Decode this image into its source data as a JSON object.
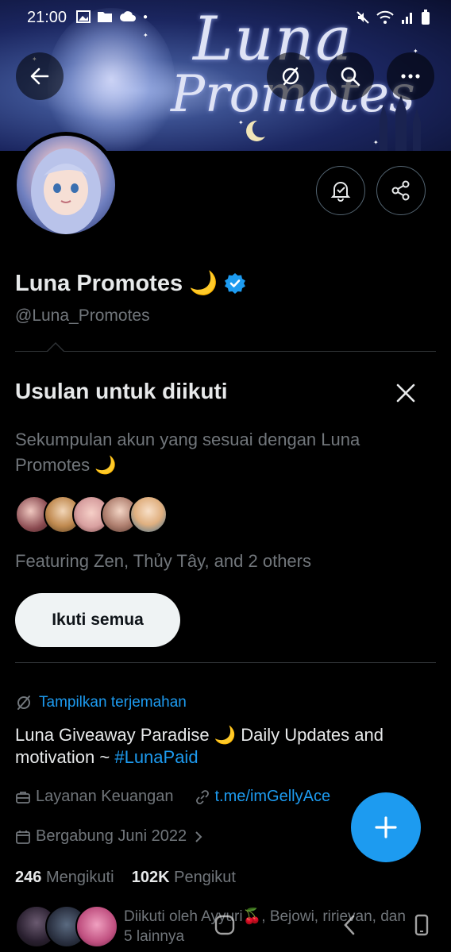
{
  "status_bar": {
    "time": "21:00"
  },
  "banner": {
    "brand_line1": "Luna",
    "brand_line2": "Promotes"
  },
  "profile": {
    "name": "Luna Promotes",
    "name_emoji": "🌙",
    "handle": "@Luna_Promotes",
    "verified_color": "#1d9bf0"
  },
  "suggestions": {
    "title": "Usulan untuk diikuti",
    "description": "Sekumpulan akun yang sesuai dengan Luna Promotes 🌙",
    "featuring": "Featuring Zen, Thủy Tây, and 2 others",
    "follow_all_label": "Ikuti semua"
  },
  "bio": {
    "translate_label": "Tampilkan terjemahan",
    "text_before_tag": "Luna Giveaway Paradise 🌙 Daily Updates and motivation ~ ",
    "hashtag": "#LunaPaid"
  },
  "meta": {
    "category": "Layanan Keuangan",
    "link": "t.me/imGellyAce",
    "joined": "Bergabung Juni 2022"
  },
  "stats": {
    "following_count": "246",
    "following_label": "Mengikuti",
    "followers_count": "102K",
    "followers_label": "Pengikut"
  },
  "followed_by": "Diikuti oleh Ayyuri🍒, Bejowi, ririevan, dan 5 lainnya",
  "colors": {
    "accent": "#1d9bf0",
    "muted": "#71767b",
    "background": "#000000"
  }
}
